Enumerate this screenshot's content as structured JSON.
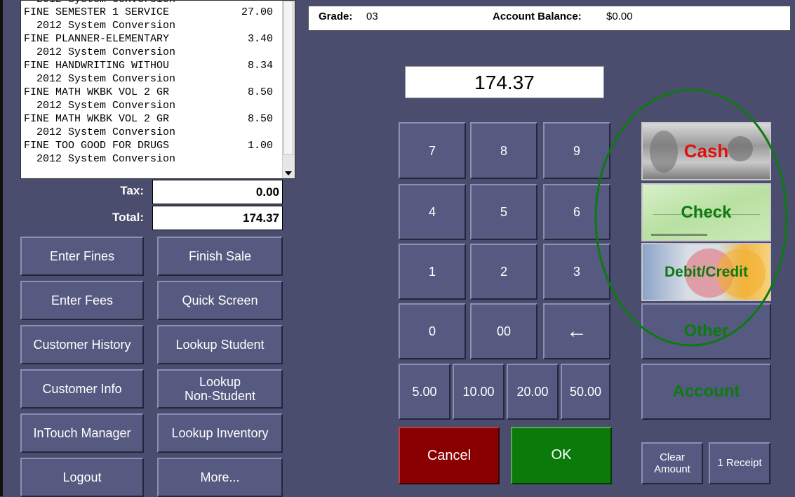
{
  "receipt": {
    "lines": [
      {
        "desc": "FINE SEMESTER 1 SERVICE",
        "amount": "27.00"
      },
      {
        "desc": "  2012 System Conversion",
        "amount": ""
      },
      {
        "desc": "FINE PLANNER-ELEMENTARY",
        "amount": "3.40"
      },
      {
        "desc": "  2012 System Conversion",
        "amount": ""
      },
      {
        "desc": "FINE HANDWRITING WITHOU",
        "amount": "8.34"
      },
      {
        "desc": "  2012 System Conversion",
        "amount": ""
      },
      {
        "desc": "FINE MATH WKBK VOL 2 GR",
        "amount": "8.50"
      },
      {
        "desc": "  2012 System Conversion",
        "amount": ""
      },
      {
        "desc": "FINE MATH WKBK VOL 2 GR",
        "amount": "8.50"
      },
      {
        "desc": "  2012 System Conversion",
        "amount": ""
      },
      {
        "desc": "FINE TOO GOOD FOR DRUGS",
        "amount": "1.00"
      },
      {
        "desc": "  2012 System Conversion",
        "amount": ""
      }
    ]
  },
  "totals": {
    "tax_label": "Tax:",
    "tax_value": "0.00",
    "total_label": "Total:",
    "total_value": "174.37"
  },
  "left_buttons": {
    "enter_fines": "Enter Fines",
    "finish_sale": "Finish Sale",
    "enter_fees": "Enter Fees",
    "quick_screen": "Quick Screen",
    "customer_history": "Customer History",
    "lookup_student": "Lookup Student",
    "customer_info": "Customer Info",
    "lookup_non_student_1": "Lookup",
    "lookup_non_student_2": "Non-Student",
    "intouch_manager": "InTouch Manager",
    "lookup_inventory": "Lookup Inventory",
    "logout": "Logout",
    "more": "More..."
  },
  "info": {
    "grade_label": "Grade:",
    "grade_value": "03",
    "balance_label": "Account Balance:",
    "balance_value": "$0.00"
  },
  "amount_display": "174.37",
  "keypad": {
    "k7": "7",
    "k8": "8",
    "k9": "9",
    "k4": "4",
    "k5": "5",
    "k6": "6",
    "k1": "1",
    "k2": "2",
    "k3": "3",
    "k0": "0",
    "k00": "00",
    "back": "←",
    "q5": "5.00",
    "q10": "10.00",
    "q20": "20.00",
    "q50": "50.00",
    "cancel": "Cancel",
    "ok": "OK"
  },
  "payment": {
    "cash": "Cash",
    "check": "Check",
    "debit_credit": "Debit/Credit",
    "other": "Other",
    "account": "Account",
    "clear_amount_1": "Clear",
    "clear_amount_2": "Amount",
    "receipt": "1 Receipt"
  },
  "colors": {
    "background": "#4a4d6e",
    "button": "#565a80",
    "cancel": "#8a0000",
    "ok": "#0a7a0a",
    "highlight_circle": "#0d7a10"
  }
}
